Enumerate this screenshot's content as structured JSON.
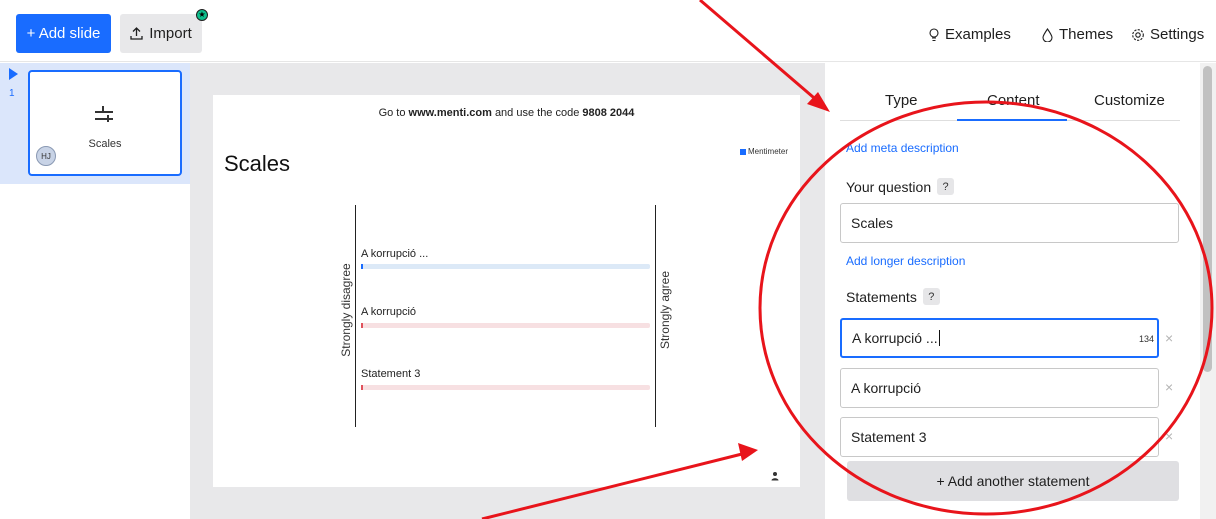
{
  "toolbar": {
    "add_slide_label": "+ Add slide",
    "import_label": "Import",
    "import_icon": "upload-icon",
    "examples_label": "Examples",
    "themes_label": "Themes",
    "settings_label": "Settings"
  },
  "slides": [
    {
      "number": "1",
      "label": "Scales",
      "avatar": "HJ",
      "icon": "scales-icon"
    }
  ],
  "preview": {
    "code_prefix": "Go to",
    "code_url": "www.menti.com",
    "code_mid": "and use the code",
    "code_value": "9808 2044",
    "title": "Scales",
    "brand": "Mentimeter",
    "left_scale_label": "Strongly disagree",
    "right_scale_label": "Strongly agree",
    "statements": [
      {
        "label": "A korrupció ...",
        "color": "#9cc3f0"
      },
      {
        "label": "A korrupció",
        "color": "#f1b9bd"
      },
      {
        "label": "Statement 3",
        "color": "#f1b9bd"
      }
    ]
  },
  "editor": {
    "tabs": [
      {
        "label": "Type",
        "active": false
      },
      {
        "label": "Content",
        "active": true
      },
      {
        "label": "Customize",
        "active": false
      }
    ],
    "meta_link": "Add meta description",
    "question_label": "Your question",
    "question_value": "Scales",
    "longer_desc_link": "Add longer description",
    "statements_label": "Statements",
    "help_glyph": "?",
    "statements": [
      {
        "value": "A korrupció ...",
        "counter": "134",
        "focused": true
      },
      {
        "value": "A korrupció",
        "counter": "",
        "focused": false
      },
      {
        "value": "Statement 3",
        "counter": "",
        "focused": false
      }
    ],
    "add_statement_label": "+ Add another statement"
  },
  "colors": {
    "accent": "#196cff",
    "annotation": "#e8141b"
  }
}
